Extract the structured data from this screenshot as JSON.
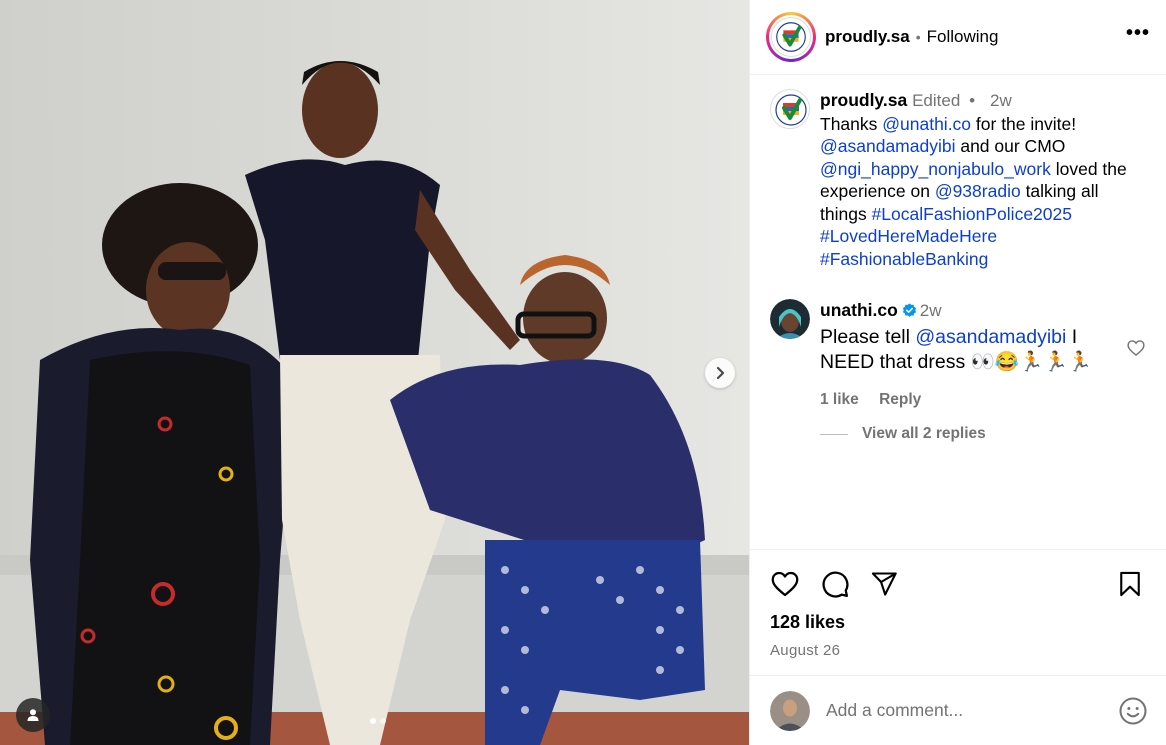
{
  "post": {
    "author": "proudly.sa",
    "separator": "•",
    "follow_status": "Following",
    "more_label": "•••"
  },
  "caption": {
    "author": "proudly.sa",
    "edited": "Edited",
    "dot": "•",
    "time": "2w",
    "parts": [
      {
        "t": "Thanks ",
        "link": false
      },
      {
        "t": "@unathi.co",
        "link": true
      },
      {
        "t": " for the invite! ",
        "link": false
      },
      {
        "t": "@asandamadyibi",
        "link": true
      },
      {
        "t": " and our CMO ",
        "link": false
      },
      {
        "t": "@ngi_happy_nonjabulo_work",
        "link": true
      },
      {
        "t": " loved the experience on ",
        "link": false
      },
      {
        "t": "@938radio",
        "link": true
      },
      {
        "t": " talking all things ",
        "link": false
      },
      {
        "t": "#LocalFashionPolice2025",
        "link": true
      },
      {
        "t": " ",
        "link": false
      },
      {
        "t": "#LovedHereMadeHere",
        "link": true
      },
      {
        "t": " ",
        "link": false
      },
      {
        "t": "#FashionableBanking",
        "link": true
      }
    ]
  },
  "comment": {
    "author": "unathi.co",
    "time": "2w",
    "text_before": "Please tell ",
    "mention": "@asandamadyibi",
    "text_after": " I NEED that dress 👀😂🏃🏃🏃",
    "likes": "1 like",
    "reply": "Reply",
    "view_replies": "View all 2 replies"
  },
  "actions": {
    "likes": "128 likes",
    "date": "August 26"
  },
  "composer": {
    "placeholder": "Add a comment..."
  },
  "colors": {
    "link": "#0c3fd0",
    "muted": "#737373",
    "verified": "#0095f6"
  },
  "icons": [
    "more-options-icon",
    "verified-badge-icon",
    "heart-icon",
    "comment-icon",
    "share-icon",
    "bookmark-icon",
    "emoji-icon",
    "chevron-right-icon",
    "user-tag-icon"
  ]
}
